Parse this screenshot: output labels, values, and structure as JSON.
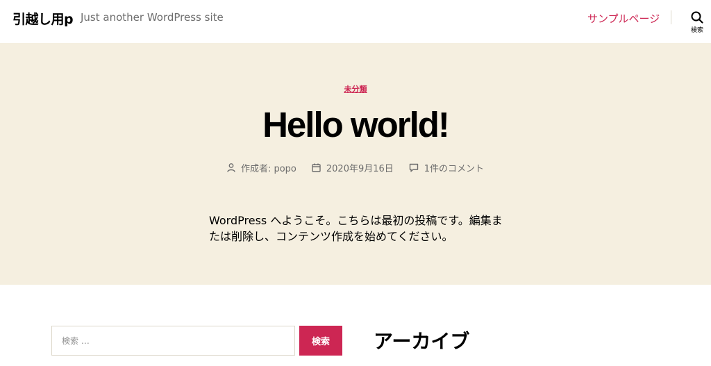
{
  "header": {
    "site_title": "引越し用p",
    "site_description": "Just another WordPress site",
    "nav_link": "サンプルページ",
    "search_label": "検索"
  },
  "post": {
    "category": "未分類",
    "title": "Hello world!",
    "author": "作成者: popo",
    "date": "2020年9月16日",
    "comments": "1件のコメント",
    "content_line1": "WordPress へようこそ。こちらは最初の投稿です。編集ま",
    "content_line2": "たは削除し、コンテンツ作成を始めてください。"
  },
  "widgets": {
    "search_placeholder": "検索 …",
    "search_button": "検索",
    "archive_title": "アーカイブ"
  },
  "colors": {
    "accent": "#cd2653",
    "hero_bg": "#f5efe0",
    "secondary_text": "#6d6d6d"
  },
  "icons": {
    "search": "search-icon",
    "author": "person-icon",
    "date": "calendar-icon",
    "comments": "comment-icon"
  }
}
